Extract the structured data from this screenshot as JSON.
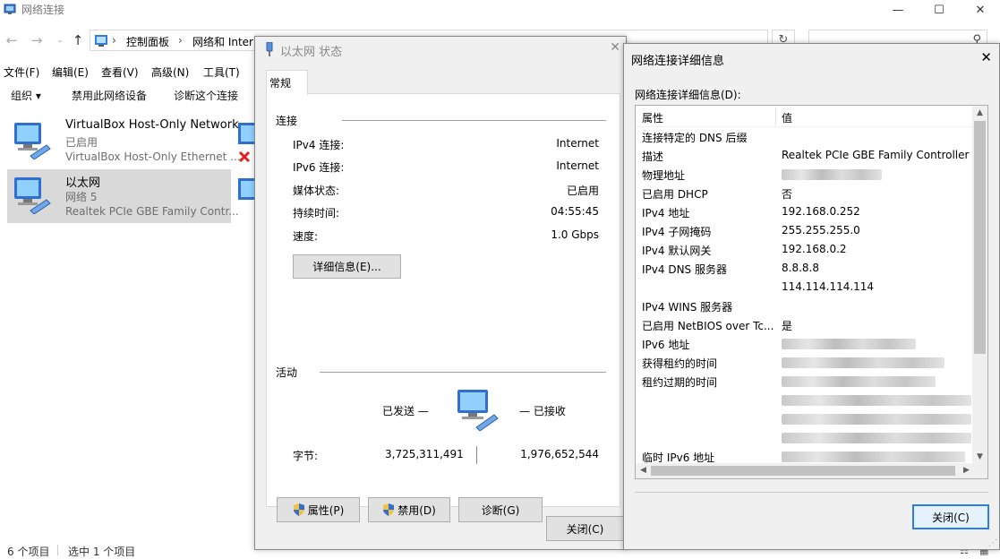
{
  "explorer": {
    "title": "网络连接",
    "breadcrumbs": [
      "控制面板",
      "网络和 Interi"
    ],
    "menu": [
      "文件(F)",
      "编辑(E)",
      "查看(V)",
      "高级(N)",
      "工具(T)"
    ],
    "toolbar": {
      "organize": "组织 ▾",
      "disable": "禁用此网络设备",
      "diagnose": "诊断这个连接"
    },
    "items": [
      {
        "name": "VirtualBox Host-Only Network",
        "status": "已启用",
        "adapter": "VirtualBox Host-Only Ethernet ..."
      },
      {
        "name": "以太网",
        "status": "网络 5",
        "adapter": "Realtek PCIe GBE Family Contr..."
      }
    ],
    "status": {
      "count": "6 个项目",
      "selected": "选中 1 个项目"
    }
  },
  "status_dialog": {
    "title": "以太网 状态",
    "tab": "常规",
    "connection_group": "连接",
    "rows": [
      {
        "label": "IPv4 连接:",
        "value": "Internet"
      },
      {
        "label": "IPv6 连接:",
        "value": "Internet"
      },
      {
        "label": "媒体状态:",
        "value": "已启用"
      },
      {
        "label": "持续时间:",
        "value": "04:55:45"
      },
      {
        "label": "速度:",
        "value": "1.0 Gbps"
      }
    ],
    "details_button": "详细信息(E)...",
    "activity_group": "活动",
    "sent_label": "已发送 —",
    "received_label": "— 已接收",
    "bytes_label": "字节:",
    "bytes_sent": "3,725,311,491",
    "bytes_received": "1,976,652,544",
    "properties_button": "属性(P)",
    "disable_button": "禁用(D)",
    "diagnose_button": "诊断(G)",
    "close_button": "关闭(C)"
  },
  "details_dialog": {
    "title": "网络连接详细信息",
    "caption": "网络连接详细信息(D):",
    "col_property": "属性",
    "col_value": "值",
    "rows": [
      {
        "prop": "连接特定的 DNS 后缀",
        "value": ""
      },
      {
        "prop": "描述",
        "value": "Realtek PCIe GBE Family Controller"
      },
      {
        "prop": "物理地址",
        "value": ""
      },
      {
        "prop": "已启用 DHCP",
        "value": "否"
      },
      {
        "prop": "IPv4 地址",
        "value": "192.168.0.252"
      },
      {
        "prop": "IPv4 子网掩码",
        "value": "255.255.255.0"
      },
      {
        "prop": "IPv4 默认网关",
        "value": "192.168.0.2"
      },
      {
        "prop": "IPv4 DNS 服务器",
        "value": "8.8.8.8"
      },
      {
        "prop": "",
        "value": "114.114.114.114"
      },
      {
        "prop": "IPv4 WINS 服务器",
        "value": ""
      },
      {
        "prop": "已启用 NetBIOS over Tc...",
        "value": "是"
      },
      {
        "prop": "IPv6 地址",
        "value": ""
      },
      {
        "prop": "获得租约的时间",
        "value": ""
      },
      {
        "prop": "租约过期的时间",
        "value": ""
      },
      {
        "prop": "",
        "value": ""
      },
      {
        "prop": "",
        "value": ""
      },
      {
        "prop": "",
        "value": ""
      },
      {
        "prop": "临时 IPv6 地址",
        "value": ""
      }
    ],
    "close_button": "关闭(C)"
  }
}
